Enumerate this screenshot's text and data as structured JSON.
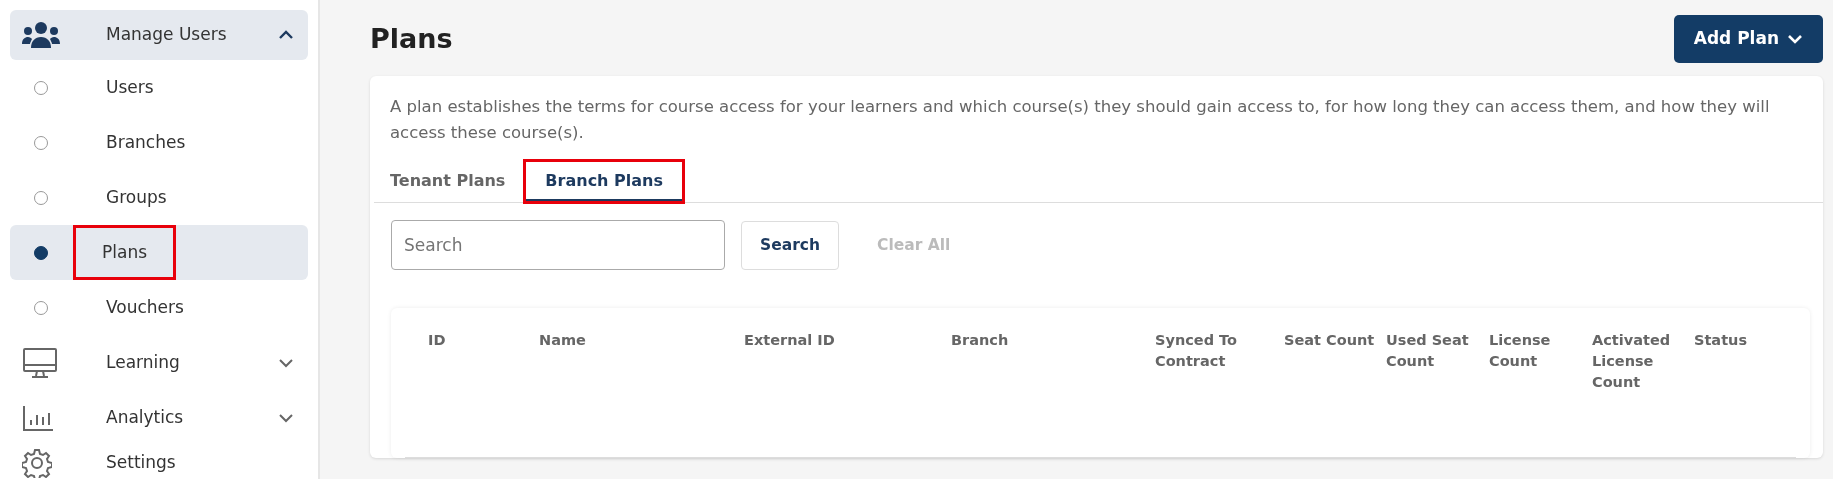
{
  "sidebar": {
    "items": [
      {
        "label": "Manage Users",
        "kind": "section",
        "expanded": true,
        "children": [
          {
            "label": "Users",
            "selected": false,
            "highlighted": false
          },
          {
            "label": "Branches",
            "selected": false,
            "highlighted": false
          },
          {
            "label": "Groups",
            "selected": false,
            "highlighted": false
          },
          {
            "label": "Plans",
            "selected": true,
            "highlighted": true
          },
          {
            "label": "Vouchers",
            "selected": false,
            "highlighted": false
          }
        ]
      },
      {
        "label": "Learning",
        "kind": "section",
        "expanded": false
      },
      {
        "label": "Analytics",
        "kind": "section",
        "expanded": false
      },
      {
        "label": "Settings",
        "kind": "link"
      }
    ]
  },
  "page": {
    "title": "Plans",
    "add_button": "Add Plan"
  },
  "description": "A plan establishes the terms for course access for your learners and which course(s) they should gain access to, for how long they can access them, and how they will access these course(s).",
  "tabs": [
    {
      "label": "Tenant Plans",
      "selected": false,
      "highlighted": false
    },
    {
      "label": "Branch Plans",
      "selected": true,
      "highlighted": true
    }
  ],
  "search": {
    "placeholder": "Search",
    "button": "Search",
    "clear": "Clear All"
  },
  "table": {
    "columns": [
      "ID",
      "Name",
      "External ID",
      "Branch",
      "Synced To Contract",
      "Seat Count",
      "Used Seat Count",
      "License Count",
      "Activated License Count",
      "Status"
    ]
  }
}
